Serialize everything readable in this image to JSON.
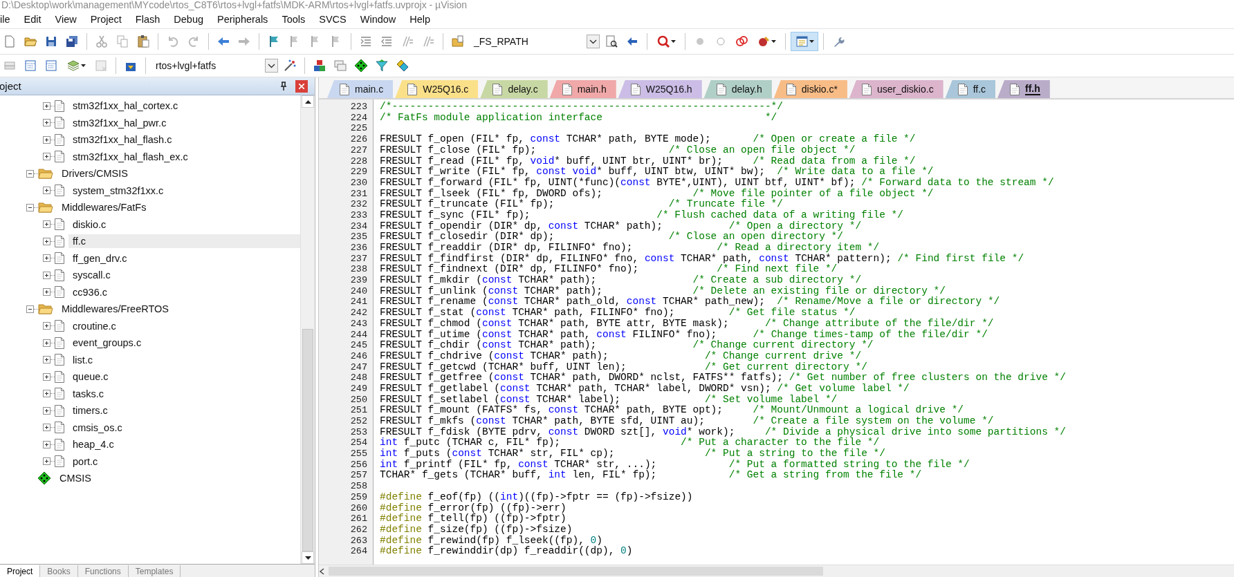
{
  "title": "D:\\Desktop\\work\\management\\MYcode\\rtos_C8T6\\rtos+lvgl+fatfs\\MDK-ARM\\rtos+lvgl+fatfs.uvprojx - µVision",
  "menu": [
    "ile",
    "Edit",
    "View",
    "Project",
    "Flash",
    "Debug",
    "Peripherals",
    "Tools",
    "SVCS",
    "Window",
    "Help"
  ],
  "toolbar": {
    "find_text": "_FS_RPATH",
    "view_button_pressed": true
  },
  "build_toolbar": {
    "target": "rtos+lvgl+fatfs"
  },
  "project_panel": {
    "title": "oject",
    "tree": [
      {
        "kind": "group_tail",
        "children": [
          {
            "kind": "file",
            "label": "stm32f1xx_hal_cortex.c",
            "expanded": false,
            "selected": false
          },
          {
            "kind": "file",
            "label": "stm32f1xx_hal_pwr.c",
            "expanded": false,
            "selected": false
          },
          {
            "kind": "file",
            "label": "stm32f1xx_hal_flash.c",
            "expanded": false,
            "selected": false
          },
          {
            "kind": "file",
            "label": "stm32f1xx_hal_flash_ex.c",
            "expanded": false,
            "selected": false
          }
        ]
      },
      {
        "kind": "folder",
        "label": "Drivers/CMSIS",
        "expanded": true,
        "selected": false,
        "children": [
          {
            "kind": "file",
            "label": "system_stm32f1xx.c",
            "expanded": false,
            "selected": false
          }
        ]
      },
      {
        "kind": "folder",
        "label": "Middlewares/FatFs",
        "expanded": true,
        "selected": false,
        "children": [
          {
            "kind": "file",
            "label": "diskio.c",
            "expanded": false,
            "selected": false
          },
          {
            "kind": "file",
            "label": "ff.c",
            "expanded": false,
            "selected": true
          },
          {
            "kind": "file",
            "label": "ff_gen_drv.c",
            "expanded": false,
            "selected": false
          },
          {
            "kind": "file",
            "label": "syscall.c",
            "expanded": false,
            "selected": false
          },
          {
            "kind": "file",
            "label": "cc936.c",
            "expanded": false,
            "selected": false
          }
        ]
      },
      {
        "kind": "folder",
        "label": "Middlewares/FreeRTOS",
        "expanded": true,
        "selected": false,
        "children": [
          {
            "kind": "file",
            "label": "croutine.c",
            "expanded": false,
            "selected": false
          },
          {
            "kind": "file",
            "label": "event_groups.c",
            "expanded": false,
            "selected": false
          },
          {
            "kind": "file",
            "label": "list.c",
            "expanded": false,
            "selected": false
          },
          {
            "kind": "file",
            "label": "queue.c",
            "expanded": false,
            "selected": false
          },
          {
            "kind": "file",
            "label": "tasks.c",
            "expanded": false,
            "selected": false
          },
          {
            "kind": "file",
            "label": "timers.c",
            "expanded": false,
            "selected": false
          },
          {
            "kind": "file",
            "label": "cmsis_os.c",
            "expanded": false,
            "selected": false
          },
          {
            "kind": "file",
            "label": "heap_4.c",
            "expanded": false,
            "selected": false
          },
          {
            "kind": "file",
            "label": "port.c",
            "expanded": false,
            "selected": false
          }
        ]
      },
      {
        "kind": "component",
        "label": "CMSIS",
        "selected": false
      }
    ],
    "tabs": [
      {
        "label": "Project",
        "selected": true
      },
      {
        "label": "Books",
        "selected": false
      },
      {
        "label": "Functions",
        "selected": false
      },
      {
        "label": "Templates",
        "selected": false
      }
    ]
  },
  "editor": {
    "tabs": [
      {
        "label": "main.c",
        "color": "#c9d8f0",
        "selected": false
      },
      {
        "label": "W25Q16.c",
        "color": "#fbe08a",
        "selected": false
      },
      {
        "label": "delay.c",
        "color": "#c8d8a4",
        "selected": false
      },
      {
        "label": "main.h",
        "color": "#f0a8a8",
        "selected": false
      },
      {
        "label": "W25Q16.h",
        "color": "#cbbde6",
        "selected": false
      },
      {
        "label": "delay.h",
        "color": "#b0cfc6",
        "selected": false
      },
      {
        "label": "diskio.c*",
        "color": "#f8bc86",
        "selected": false
      },
      {
        "label": "user_diskio.c",
        "color": "#dcb4cc",
        "selected": false
      },
      {
        "label": "ff.c",
        "color": "#a9c6da",
        "selected": false
      },
      {
        "label": "ff.h",
        "color": "#b9acc9",
        "selected": true
      }
    ],
    "lines": [
      {
        "number": "223",
        "segments": [
          {
            "kind": "comment",
            "text": "/*---------------------------------------------------------------*/"
          }
        ]
      },
      {
        "number": "224",
        "segments": [
          {
            "kind": "comment",
            "text": "/* FatFs module application interface                           */"
          }
        ]
      },
      {
        "number": "225"
      },
      {
        "number": "226",
        "segments": [
          {
            "kind": "plain",
            "text": "FRESULT f_open (FIL* fp, "
          },
          {
            "kind": "keyword",
            "text": "const"
          },
          {
            "kind": "plain",
            "text": " TCHAR* path, BYTE mode);       "
          },
          {
            "kind": "comment",
            "text": "/* Open or create a file */"
          }
        ]
      },
      {
        "number": "227",
        "segments": [
          {
            "kind": "plain",
            "text": "FRESULT f_close (FIL* fp);                      "
          },
          {
            "kind": "comment",
            "text": "/* Close an open file object */"
          }
        ]
      },
      {
        "number": "228",
        "segments": [
          {
            "kind": "plain",
            "text": "FRESULT f_read (FIL* fp, "
          },
          {
            "kind": "keyword",
            "text": "void"
          },
          {
            "kind": "plain",
            "text": "* buff, UINT btr, UINT* br);     "
          },
          {
            "kind": "comment",
            "text": "/* Read data from a file */"
          }
        ]
      },
      {
        "number": "229",
        "segments": [
          {
            "kind": "plain",
            "text": "FRESULT f_write (FIL* fp, "
          },
          {
            "kind": "keyword",
            "text": "const void"
          },
          {
            "kind": "plain",
            "text": "* buff, UINT btw, UINT* bw);  "
          },
          {
            "kind": "comment",
            "text": "/* Write data to a file */"
          }
        ]
      },
      {
        "number": "230",
        "segments": [
          {
            "kind": "plain",
            "text": "FRESULT f_forward (FIL* fp, UINT(*func)("
          },
          {
            "kind": "keyword",
            "text": "const"
          },
          {
            "kind": "plain",
            "text": " BYTE*,UINT), UINT btf, UINT* bf); "
          },
          {
            "kind": "comment",
            "text": "/* Forward data to the stream */"
          }
        ]
      },
      {
        "number": "231",
        "segments": [
          {
            "kind": "plain",
            "text": "FRESULT f_lseek (FIL* fp, DWORD ofs);               "
          },
          {
            "kind": "comment",
            "text": "/* Move file pointer of a file object */"
          }
        ]
      },
      {
        "number": "232",
        "segments": [
          {
            "kind": "plain",
            "text": "FRESULT f_truncate (FIL* fp);                   "
          },
          {
            "kind": "comment",
            "text": "/* Truncate file */"
          }
        ]
      },
      {
        "number": "233",
        "segments": [
          {
            "kind": "plain",
            "text": "FRESULT f_sync (FIL* fp);                     "
          },
          {
            "kind": "comment",
            "text": "/* Flush cached data of a writing file */"
          }
        ]
      },
      {
        "number": "234",
        "segments": [
          {
            "kind": "plain",
            "text": "FRESULT f_opendir (DIR* dp, "
          },
          {
            "kind": "keyword",
            "text": "const"
          },
          {
            "kind": "plain",
            "text": " TCHAR* path);           "
          },
          {
            "kind": "comment",
            "text": "/* Open a directory */"
          }
        ]
      },
      {
        "number": "235",
        "segments": [
          {
            "kind": "plain",
            "text": "FRESULT f_closedir (DIR* dp);                   "
          },
          {
            "kind": "comment",
            "text": "/* Close an open directory */"
          }
        ]
      },
      {
        "number": "236",
        "segments": [
          {
            "kind": "plain",
            "text": "FRESULT f_readdir (DIR* dp, FILINFO* fno);              "
          },
          {
            "kind": "comment",
            "text": "/* Read a directory item */"
          }
        ]
      },
      {
        "number": "237",
        "segments": [
          {
            "kind": "plain",
            "text": "FRESULT f_findfirst (DIR* dp, FILINFO* fno, "
          },
          {
            "kind": "keyword",
            "text": "const"
          },
          {
            "kind": "plain",
            "text": " TCHAR* path, "
          },
          {
            "kind": "keyword",
            "text": "const"
          },
          {
            "kind": "plain",
            "text": " TCHAR* pattern); "
          },
          {
            "kind": "comment",
            "text": "/* Find first file */"
          }
        ]
      },
      {
        "number": "238",
        "segments": [
          {
            "kind": "plain",
            "text": "FRESULT f_findnext (DIR* dp, FILINFO* fno);             "
          },
          {
            "kind": "comment",
            "text": "/* Find next file */"
          }
        ]
      },
      {
        "number": "239",
        "segments": [
          {
            "kind": "plain",
            "text": "FRESULT f_mkdir ("
          },
          {
            "kind": "keyword",
            "text": "const"
          },
          {
            "kind": "plain",
            "text": " TCHAR* path);                "
          },
          {
            "kind": "comment",
            "text": "/* Create a sub directory */"
          }
        ]
      },
      {
        "number": "240",
        "segments": [
          {
            "kind": "plain",
            "text": "FRESULT f_unlink ("
          },
          {
            "kind": "keyword",
            "text": "const"
          },
          {
            "kind": "plain",
            "text": " TCHAR* path);               "
          },
          {
            "kind": "comment",
            "text": "/* Delete an existing file or directory */"
          }
        ]
      },
      {
        "number": "241",
        "segments": [
          {
            "kind": "plain",
            "text": "FRESULT f_rename ("
          },
          {
            "kind": "keyword",
            "text": "const"
          },
          {
            "kind": "plain",
            "text": " TCHAR* path_old, "
          },
          {
            "kind": "keyword",
            "text": "const"
          },
          {
            "kind": "plain",
            "text": " TCHAR* path_new);  "
          },
          {
            "kind": "comment",
            "text": "/* Rename/Move a file or directory */"
          }
        ]
      },
      {
        "number": "242",
        "segments": [
          {
            "kind": "plain",
            "text": "FRESULT f_stat ("
          },
          {
            "kind": "keyword",
            "text": "const"
          },
          {
            "kind": "plain",
            "text": " TCHAR* path, FILINFO* fno);         "
          },
          {
            "kind": "comment",
            "text": "/* Get file status */"
          }
        ]
      },
      {
        "number": "243",
        "segments": [
          {
            "kind": "plain",
            "text": "FRESULT f_chmod ("
          },
          {
            "kind": "keyword",
            "text": "const"
          },
          {
            "kind": "plain",
            "text": " TCHAR* path, BYTE attr, BYTE mask);      "
          },
          {
            "kind": "comment",
            "text": "/* Change attribute of the file/dir */"
          }
        ]
      },
      {
        "number": "244",
        "segments": [
          {
            "kind": "plain",
            "text": "FRESULT f_utime ("
          },
          {
            "kind": "keyword",
            "text": "const"
          },
          {
            "kind": "plain",
            "text": " TCHAR* path, "
          },
          {
            "kind": "keyword",
            "text": "const"
          },
          {
            "kind": "plain",
            "text": " FILINFO* fno);      "
          },
          {
            "kind": "comment",
            "text": "/* Change times-tamp of the file/dir */"
          }
        ]
      },
      {
        "number": "245",
        "segments": [
          {
            "kind": "plain",
            "text": "FRESULT f_chdir ("
          },
          {
            "kind": "keyword",
            "text": "const"
          },
          {
            "kind": "plain",
            "text": " TCHAR* path);                "
          },
          {
            "kind": "comment",
            "text": "/* Change current directory */"
          }
        ]
      },
      {
        "number": "246",
        "segments": [
          {
            "kind": "plain",
            "text": "FRESULT f_chdrive ("
          },
          {
            "kind": "keyword",
            "text": "const"
          },
          {
            "kind": "plain",
            "text": " TCHAR* path);                "
          },
          {
            "kind": "comment",
            "text": "/* Change current drive */"
          }
        ]
      },
      {
        "number": "247",
        "segments": [
          {
            "kind": "plain",
            "text": "FRESULT f_getcwd (TCHAR* buff, UINT len);             "
          },
          {
            "kind": "comment",
            "text": "/* Get current directory */"
          }
        ]
      },
      {
        "number": "248",
        "segments": [
          {
            "kind": "plain",
            "text": "FRESULT f_getfree ("
          },
          {
            "kind": "keyword",
            "text": "const"
          },
          {
            "kind": "plain",
            "text": " TCHAR* path, DWORD* nclst, FATFS** fatfs); "
          },
          {
            "kind": "comment",
            "text": "/* Get number of free clusters on the drive */"
          }
        ]
      },
      {
        "number": "249",
        "segments": [
          {
            "kind": "plain",
            "text": "FRESULT f_getlabel ("
          },
          {
            "kind": "keyword",
            "text": "const"
          },
          {
            "kind": "plain",
            "text": " TCHAR* path, TCHAR* label, DWORD* vsn); "
          },
          {
            "kind": "comment",
            "text": "/* Get volume label */"
          }
        ]
      },
      {
        "number": "250",
        "segments": [
          {
            "kind": "plain",
            "text": "FRESULT f_setlabel ("
          },
          {
            "kind": "keyword",
            "text": "const"
          },
          {
            "kind": "plain",
            "text": " TCHAR* label);              "
          },
          {
            "kind": "comment",
            "text": "/* Set volume label */"
          }
        ]
      },
      {
        "number": "251",
        "segments": [
          {
            "kind": "plain",
            "text": "FRESULT f_mount (FATFS* fs, "
          },
          {
            "kind": "keyword",
            "text": "const"
          },
          {
            "kind": "plain",
            "text": " TCHAR* path, BYTE opt);     "
          },
          {
            "kind": "comment",
            "text": "/* Mount/Unmount a logical drive */"
          }
        ]
      },
      {
        "number": "252",
        "segments": [
          {
            "kind": "plain",
            "text": "FRESULT f_mkfs ("
          },
          {
            "kind": "keyword",
            "text": "const"
          },
          {
            "kind": "plain",
            "text": " TCHAR* path, BYTE sfd, UINT au);        "
          },
          {
            "kind": "comment",
            "text": "/* Create a file system on the volume */"
          }
        ]
      },
      {
        "number": "253",
        "segments": [
          {
            "kind": "plain",
            "text": "FRESULT f_fdisk (BYTE pdrv, "
          },
          {
            "kind": "keyword",
            "text": "const"
          },
          {
            "kind": "plain",
            "text": " DWORD szt[], "
          },
          {
            "kind": "keyword",
            "text": "void"
          },
          {
            "kind": "plain",
            "text": "* work);     "
          },
          {
            "kind": "comment",
            "text": "/* Divide a physical drive into some partitions */"
          }
        ]
      },
      {
        "number": "254",
        "segments": [
          {
            "kind": "keyword",
            "text": "int"
          },
          {
            "kind": "plain",
            "text": " f_putc (TCHAR c, FIL* fp);                    "
          },
          {
            "kind": "comment",
            "text": "/* Put a character to the file */"
          }
        ]
      },
      {
        "number": "255",
        "segments": [
          {
            "kind": "keyword",
            "text": "int"
          },
          {
            "kind": "plain",
            "text": " f_puts ("
          },
          {
            "kind": "keyword",
            "text": "const"
          },
          {
            "kind": "plain",
            "text": " TCHAR* str, FIL* cp);               "
          },
          {
            "kind": "comment",
            "text": "/* Put a string to the file */"
          }
        ]
      },
      {
        "number": "256",
        "segments": [
          {
            "kind": "keyword",
            "text": "int"
          },
          {
            "kind": "plain",
            "text": " f_printf (FIL* fp, "
          },
          {
            "kind": "keyword",
            "text": "const"
          },
          {
            "kind": "plain",
            "text": " TCHAR* str, ...);            "
          },
          {
            "kind": "comment",
            "text": "/* Put a formatted string to the file */"
          }
        ]
      },
      {
        "number": "257",
        "segments": [
          {
            "kind": "plain",
            "text": "TCHAR* f_gets (TCHAR* buff, "
          },
          {
            "kind": "keyword",
            "text": "int"
          },
          {
            "kind": "plain",
            "text": " len, FIL* fp);            "
          },
          {
            "kind": "comment",
            "text": "/* Get a string from the file */"
          }
        ]
      },
      {
        "number": "258"
      },
      {
        "number": "259",
        "segments": [
          {
            "kind": "directive",
            "text": "#define"
          },
          {
            "kind": "plain",
            "text": " f_eof(fp) (("
          },
          {
            "kind": "keyword",
            "text": "int"
          },
          {
            "kind": "plain",
            "text": ")((fp)->fptr == (fp)->fsize))"
          }
        ]
      },
      {
        "number": "260",
        "segments": [
          {
            "kind": "directive",
            "text": "#define"
          },
          {
            "kind": "plain",
            "text": " f_error(fp) ((fp)->err)"
          }
        ]
      },
      {
        "number": "261",
        "segments": [
          {
            "kind": "directive",
            "text": "#define"
          },
          {
            "kind": "plain",
            "text": " f_tell(fp) ((fp)->fptr)"
          }
        ]
      },
      {
        "number": "262",
        "segments": [
          {
            "kind": "directive",
            "text": "#define"
          },
          {
            "kind": "plain",
            "text": " f_size(fp) ((fp)->fsize)"
          }
        ]
      },
      {
        "number": "263",
        "segments": [
          {
            "kind": "directive",
            "text": "#define"
          },
          {
            "kind": "plain",
            "text": " f_rewind(fp) f_lseek((fp), "
          },
          {
            "kind": "number",
            "text": "0"
          },
          {
            "kind": "plain",
            "text": ")"
          }
        ]
      },
      {
        "number": "264",
        "segments": [
          {
            "kind": "directive",
            "text": "#define"
          },
          {
            "kind": "plain",
            "text": " f_rewinddir(dp) f_readdir((dp), "
          },
          {
            "kind": "number",
            "text": "0"
          },
          {
            "kind": "plain",
            "text": ")"
          }
        ]
      }
    ]
  }
}
